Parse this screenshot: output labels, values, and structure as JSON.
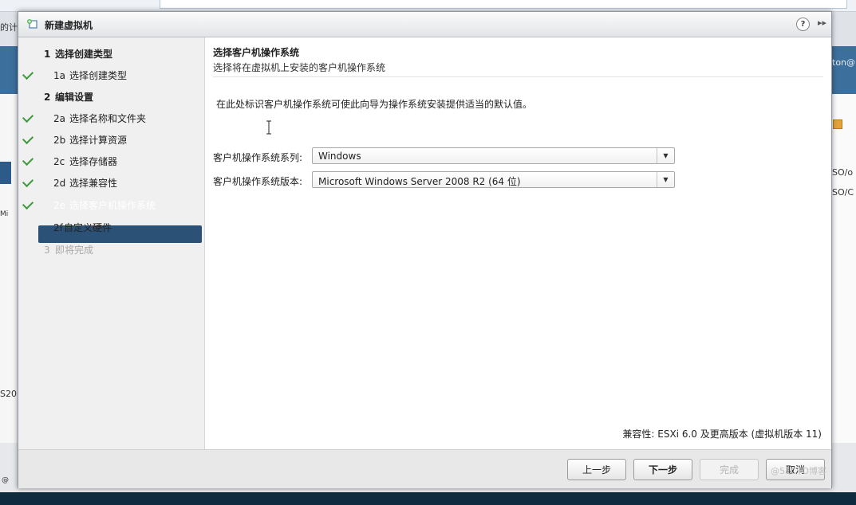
{
  "background": {
    "fragments": {
      "top_left": "的计",
      "right_user": "ton@",
      "right_1": "SO/o",
      "right_2": "SO/C",
      "left_mid": "Mi",
      "left_low": "S20",
      "left_bottom": "@"
    }
  },
  "dialog": {
    "title": "新建虚拟机",
    "help_icon": "?",
    "expand_icon": "▸▸"
  },
  "nav": {
    "items": [
      {
        "num": "1",
        "label": "选择创建类型",
        "state": "header-bold",
        "check": false
      },
      {
        "num": "1a",
        "label": "选择创建类型",
        "state": "done",
        "check": true
      },
      {
        "num": "2",
        "label": "编辑设置",
        "state": "header-bold",
        "check": false
      },
      {
        "num": "2a",
        "label": "选择名称和文件夹",
        "state": "done",
        "check": true
      },
      {
        "num": "2b",
        "label": "选择计算资源",
        "state": "done",
        "check": true
      },
      {
        "num": "2c",
        "label": "选择存储器",
        "state": "done",
        "check": true
      },
      {
        "num": "2d",
        "label": "选择兼容性",
        "state": "done",
        "check": true
      },
      {
        "num": "2e",
        "label": "选择客户机操作系统",
        "state": "selected",
        "check": true
      },
      {
        "num": "2f",
        "label": "自定义硬件",
        "state": "normal",
        "check": false
      },
      {
        "num": "3",
        "label": "即将完成",
        "state": "disabled",
        "check": false
      }
    ]
  },
  "content": {
    "title": "选择客户机操作系统",
    "subtitle": "选择将在虚拟机上安装的客户机操作系统",
    "description": "在此处标识客户机操作系统可使此向导为操作系统安装提供适当的默认值。",
    "os_family_label": "客户机操作系统系列:",
    "os_family_value": "Windows",
    "os_version_label": "客户机操作系统版本:",
    "os_version_value": "Microsoft Windows Server 2008 R2 (64 位)",
    "compatibility": "兼容性: ESXi 6.0 及更高版本 (虚拟机版本 11)"
  },
  "footer": {
    "back": "上一步",
    "next": "下一步",
    "finish": "完成",
    "cancel": "取消",
    "watermark": "@51CTO博客"
  },
  "colors": {
    "selected_bg": "#2c5177",
    "check_green": "#3d9a3d",
    "header_band": "#3d6f9c"
  }
}
